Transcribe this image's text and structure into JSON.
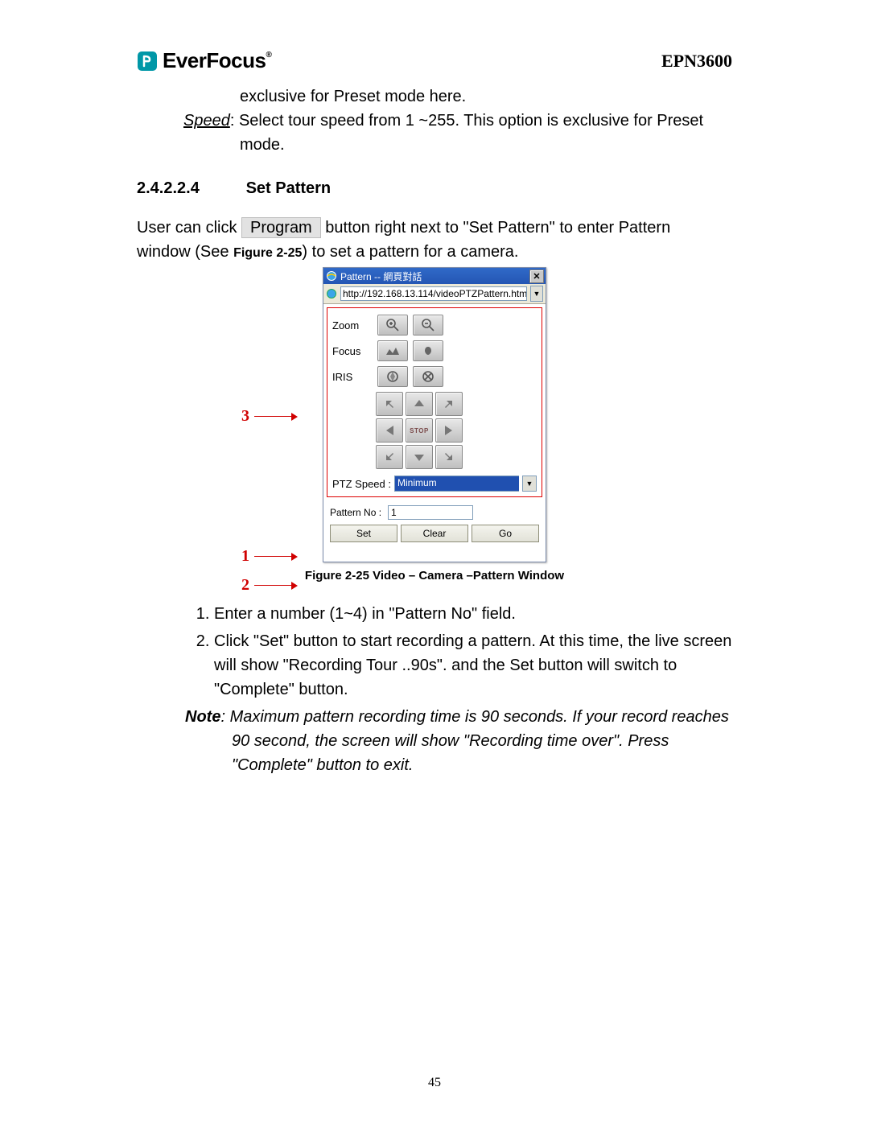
{
  "header": {
    "brand": "EverFocus",
    "model": "EPN3600"
  },
  "intro": {
    "line1": "exclusive for Preset mode here.",
    "speed_label": "Speed",
    "speed_text": ": Select tour speed from 1 ~255. This option is exclusive for Preset",
    "speed_text2": "mode."
  },
  "section": {
    "number": "2.4.2.2.4",
    "title": "Set Pattern"
  },
  "para": {
    "t1": "User can click ",
    "btn": "Program",
    "t2": " button right next to \"Set Pattern\" to enter Pattern",
    "t3": "window (See ",
    "figref": "Figure 2-25",
    "t4": ") to set a pattern for a camera."
  },
  "window": {
    "title": "Pattern -- 網頁對話",
    "url": "http://192.168.13.114/videoPTZPattern.htm",
    "labels": {
      "zoom": "Zoom",
      "focus": "Focus",
      "iris": "IRIS",
      "speed": "PTZ Speed :",
      "speed_val": "Minimum",
      "stop": "STOP",
      "pattern_no": "Pattern No :",
      "pattern_val": "1",
      "set": "Set",
      "clear": "Clear",
      "go": "Go"
    }
  },
  "callouts": {
    "a": "3",
    "b": "1",
    "c": "2"
  },
  "caption": "Figure 2-25 Video – Camera –Pattern Window",
  "steps": {
    "s1": "Enter a number (1~4) in \"Pattern No\" field.",
    "s2": "Click \"Set\" button to start recording a pattern. At this time, the live screen will show \"Recording Tour ..90s\". and the Set button will switch to \"Complete\" button."
  },
  "note": {
    "label": "Note",
    "text": ": Maximum pattern recording time is 90 seconds. If your record reaches 90 second, the screen will show \"Recording time over\". Press \"Complete\" button to exit."
  },
  "page_number": "45"
}
